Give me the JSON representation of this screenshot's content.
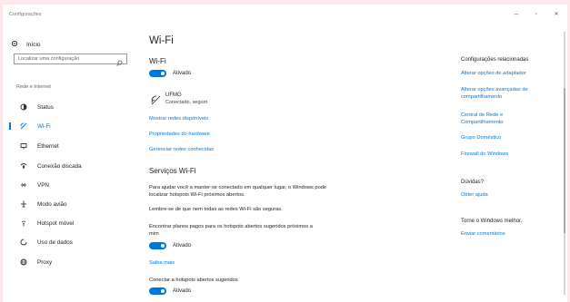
{
  "window": {
    "title": "Configurações",
    "controls": {
      "minimize": "–",
      "maximize": "▫",
      "close": "✕"
    }
  },
  "sidebar": {
    "home_label": "Início",
    "search_placeholder": "Localizar uma configuração",
    "section_label": "Rede e Internet",
    "items": [
      {
        "label": "Status",
        "icon": "status-icon"
      },
      {
        "label": "Wi-Fi",
        "icon": "wifi-icon",
        "active": true
      },
      {
        "label": "Ethernet",
        "icon": "ethernet-icon"
      },
      {
        "label": "Conexão discada",
        "icon": "dialup-icon"
      },
      {
        "label": "VPN",
        "icon": "vpn-icon"
      },
      {
        "label": "Modo avião",
        "icon": "airplane-icon"
      },
      {
        "label": "Hotspot móvel",
        "icon": "hotspot-icon"
      },
      {
        "label": "Uso de dados",
        "icon": "data-usage-icon"
      },
      {
        "label": "Proxy",
        "icon": "proxy-icon"
      }
    ]
  },
  "main": {
    "page_title": "Wi-Fi",
    "wifi_heading": "Wi-Fi",
    "wifi_toggle_label": "Ativado",
    "network": {
      "name": "UFMG",
      "status": "Conectado, seguro"
    },
    "links": [
      "Mostrar redes disponíveis",
      "Propriedades do hardware",
      "Gerenciar redes conhecidas"
    ],
    "services_heading": "Serviços Wi-Fi",
    "services_text_1": "Para ajudar você a manter-se conectado em qualquer lugar, o Windows pode localizar hotspots Wi-Fi próximos abertos.",
    "services_text_2": "Lembre-se de que nem todas as redes Wi-Fi são seguras.",
    "paid_plans_text": "Encontrar planos pagos para os hotspots abertos sugeridos próximos a mim",
    "paid_plans_toggle_label": "Ativado",
    "learn_more": "Saiba mais",
    "connect_text": "Conectar a hotspots abertos sugeridos",
    "connect_toggle_label": "Ativado"
  },
  "related": {
    "heading": "Configurações relacionadas",
    "links": [
      "Alterar opções de adaptador",
      "Alterar opções avançadas de compartilhamento",
      "Central de Rede e Compartilhamento",
      "Grupo Doméstico",
      "Firewall do Windows"
    ],
    "questions_heading": "Dúvidas?",
    "help_link": "Obter ajuda",
    "improve_heading": "Torne o Windows melhor.",
    "feedback_link": "Enviar comentários"
  },
  "colors": {
    "accent": "#0078d7",
    "background": "#ffffff",
    "frame": "#fbe9ec"
  }
}
